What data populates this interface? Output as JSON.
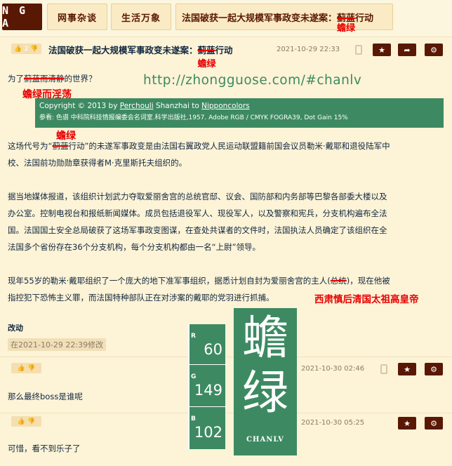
{
  "nav": {
    "logo": "N G A",
    "crumbs": [
      "网事杂谈",
      "生活万象",
      "法国破获一起大规模军事政变未遂案："
    ],
    "crumb3_strike": "蓟蓝",
    "crumb3_tail": "行动",
    "crumb3_sub": "蟾绿"
  },
  "main_post": {
    "likes": "2",
    "title_prefix": "法国破获一起大规模军事政变未遂案：",
    "title_strike": "蓟蓝",
    "title_tail": "行动",
    "title_sub": "蟾绿",
    "date": "2021-10-29 22:33",
    "line1_prefix": "为了",
    "line1_strike": "蓟蓝而清静",
    "line1_tail": "的世界？",
    "line1_sub": "蟾绿而淫荡",
    "url": "http://zhongguose.com/#chanlv",
    "banner_copyright": "Copyright © 2013 by ",
    "banner_author": "Perchouli",
    "banner_mid": "  Shanzhai to ",
    "banner_site": "Nipponcolors",
    "banner_ref": "参看: 色谱 中科院科技情报编委会名词室.科学出版社,1957. Adobe RGB / CMYK FOGRA39, Dot Gain 15%",
    "above_para_red": "蟾绿",
    "para1_a": "这场代号为“",
    "para1_strike": "蓟蓝",
    "para1_b": "行动”的未遂军事政变是由法国右翼政党人民运动联盟籍前国会议员勒米·戴耶和退役陆军中",
    "para1_c": "校、法国前功勋勋章获得者M·克里斯托夫组织的。",
    "para2_l1": "据当地媒体报道，该组织计划武力夺取爱丽舍宫的总统官邸、议会、国防部和内务部等巴黎各部委大楼以及",
    "para2_l2": "办公室。控制电视台和报纸新闻媒体。成员包括退役军人、现役军人，以及警察和宪兵，分支机构遍布全法",
    "para2_l3": "国。法国国土安全总局破获了这场军事政变图谋，在查处共谋者的文件时，法国执法人员确定了该组织在全",
    "para2_l4": "法国多个省份存在36个分支机构，每个分支机构都由一名“上尉”领导。",
    "para3_l1a": "现年55岁的勒米·戴耶组织了一个庞大的地下准军事组织，据悉计划自封为爱丽舍宫的主人(",
    "para3_l1_strike": "总统",
    "para3_l1b": ")，现在他被",
    "para3_l2": "指控犯下恐怖主义罪，而法国特种部队正在对涉案的戴耶的党羽进行抓捕。",
    "para3_red": "西肃慎后清国太祖高皇帝"
  },
  "edit": {
    "label": "改动",
    "note": "在2021-10-29 22:39修改"
  },
  "replies": [
    {
      "date": "2021-10-30 02:46",
      "text": "那么最终boss是谁呢"
    },
    {
      "date": "2021-10-30 05:25",
      "text": "可惜，看不到乐子了"
    }
  ],
  "swatch": {
    "r_label": "R",
    "r": "60",
    "g_label": "G",
    "g": "149",
    "b_label": "B",
    "b": "102",
    "char1": "蟾",
    "char2": "绿",
    "name": "CHANLV",
    "color": "#3d8a62"
  }
}
